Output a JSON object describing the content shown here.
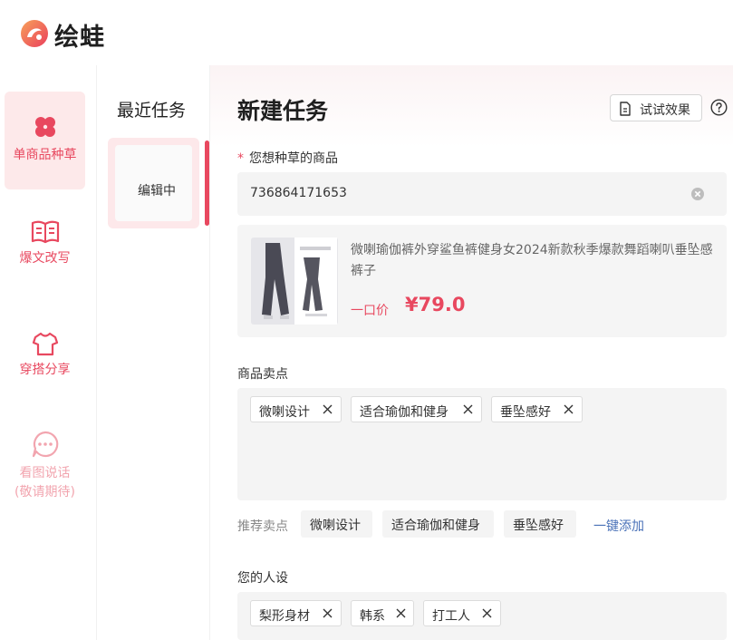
{
  "app": {
    "brand": "绘蛙"
  },
  "nav": {
    "items": [
      {
        "label": "单商品种草",
        "icon": "clover-icon",
        "active": true
      },
      {
        "label": "爆文改写",
        "icon": "book-icon"
      },
      {
        "label": "穿搭分享",
        "icon": "shirt-icon"
      },
      {
        "label": "看图说话",
        "sublabel": "(敬请期待)",
        "icon": "chat-bubble-icon",
        "disabled": true
      }
    ]
  },
  "recent": {
    "title": "最近任务",
    "card_label": "编辑中"
  },
  "main": {
    "title": "新建任务",
    "try_button": "试试效果",
    "product_field": {
      "label": "您想种草的商品",
      "value": "736864171653"
    },
    "product": {
      "title": "微喇瑜伽裤外穿鲨鱼裤健身女2024新款秋季爆款舞蹈喇叭垂坠感裤子",
      "price_label": "一口价",
      "price_value": "¥79.0"
    },
    "selling_points": {
      "label": "商品卖点",
      "tags": [
        "微喇设计",
        "适合瑜伽和健身",
        "垂坠感好"
      ],
      "recommend_label": "推荐卖点",
      "recommended": [
        "微喇设计",
        "适合瑜伽和健身",
        "垂坠感好"
      ],
      "add_all": "一键添加"
    },
    "persona": {
      "label": "您的人设",
      "tags": [
        "梨形身材",
        "韩系",
        "打工人"
      ]
    }
  },
  "colors": {
    "accent": "#e8485f",
    "link": "#4a72b8",
    "panel": "#f4f4f4"
  }
}
